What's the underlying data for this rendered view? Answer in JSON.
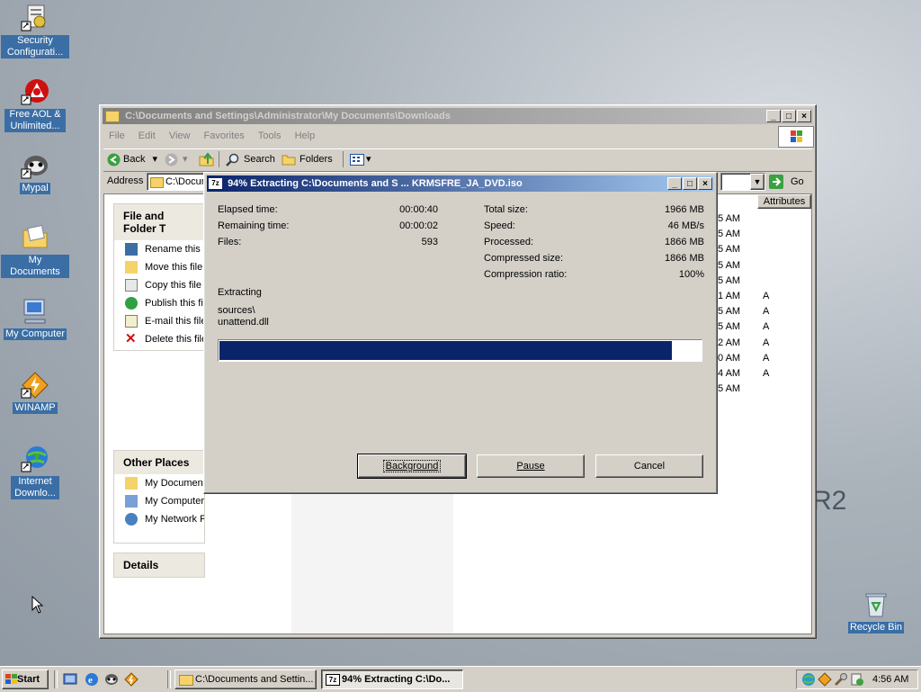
{
  "desktop": {
    "icons": [
      {
        "label": "Security Configurati...",
        "icon": "security-config-icon"
      },
      {
        "label": "Free AOL & Unlimited...",
        "icon": "aol-icon"
      },
      {
        "label": "Mypal",
        "icon": "mypal-icon"
      },
      {
        "label": "My Documents",
        "icon": "folder-documents-icon"
      },
      {
        "label": "My Computer",
        "icon": "computer-icon"
      },
      {
        "label": "WINAMP",
        "icon": "winamp-icon"
      },
      {
        "label": "Internet Downlo...",
        "icon": "internet-download-icon"
      },
      {
        "label": "Recycle Bin",
        "icon": "recycle-bin-icon"
      }
    ],
    "watermark": "3 R2"
  },
  "explorer": {
    "title": "C:\\Documents and Settings\\Administrator\\My Documents\\Downloads",
    "menu": [
      "File",
      "Edit",
      "View",
      "Favorites",
      "Tools",
      "Help"
    ],
    "toolbar": {
      "back": "Back",
      "search": "Search",
      "folders": "Folders"
    },
    "address_label": "Address",
    "address_value": "C:\\Docum",
    "go_label": "Go",
    "column_attributes": "Attributes",
    "file_tasks": {
      "title": "File and Folder T",
      "items": [
        "Rename this f",
        "Move this file",
        "Copy this file",
        "Publish this fil",
        "E-mail this file",
        "Delete this file"
      ]
    },
    "other_places": {
      "title": "Other Places",
      "items": [
        "My Document",
        "My Computer",
        "My Network P"
      ]
    },
    "details_title": "Details",
    "rows": [
      {
        "time": "5 AM",
        "attr": ""
      },
      {
        "time": "5 AM",
        "attr": ""
      },
      {
        "time": "5 AM",
        "attr": ""
      },
      {
        "time": "5 AM",
        "attr": ""
      },
      {
        "time": "5 AM",
        "attr": ""
      },
      {
        "time": "1 AM",
        "attr": "A"
      },
      {
        "time": "5 AM",
        "attr": "A"
      },
      {
        "time": "5 AM",
        "attr": "A"
      },
      {
        "time": "2 AM",
        "attr": "A"
      },
      {
        "time": "0 AM",
        "attr": "A"
      },
      {
        "time": "4 AM",
        "attr": "A"
      },
      {
        "time": "5 AM",
        "attr": ""
      }
    ]
  },
  "dialog": {
    "title": "94% Extracting C:\\Documents and S ... KRMSFRE_JA_DVD.iso",
    "left_stats": [
      {
        "label": "Elapsed time:",
        "value": "00:00:40"
      },
      {
        "label": "Remaining time:",
        "value": "00:00:02"
      },
      {
        "label": "Files:",
        "value": "593"
      }
    ],
    "right_stats": [
      {
        "label": "Total size:",
        "value": "1966 MB"
      },
      {
        "label": "Speed:",
        "value": "46 MB/s"
      },
      {
        "label": "Processed:",
        "value": "1866 MB"
      },
      {
        "label": "Compressed size:",
        "value": "1866 MB"
      },
      {
        "label": "Compression ratio:",
        "value": "100%"
      }
    ],
    "status": "Extracting",
    "path_line1": "sources\\",
    "path_line2": "unattend.dll",
    "progress": 0.94,
    "buttons": {
      "background": "Background",
      "pause": "Pause",
      "cancel": "Cancel"
    }
  },
  "taskbar": {
    "start": "Start",
    "tasks": [
      {
        "label": "C:\\Documents and Settin...",
        "active": false
      },
      {
        "label": "94% Extracting C:\\Do...",
        "active": true
      }
    ],
    "clock": "4:56 AM"
  }
}
